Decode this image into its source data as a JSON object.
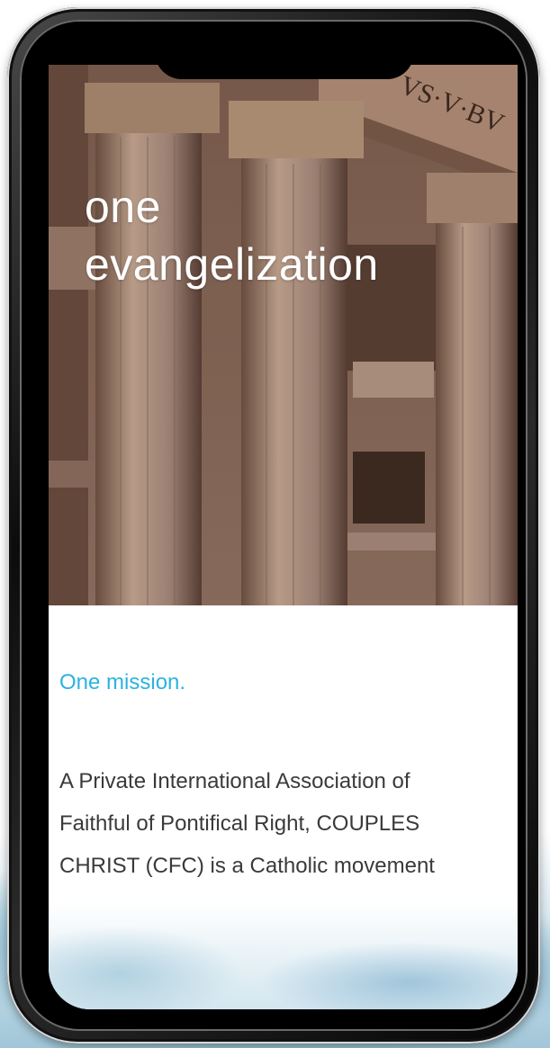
{
  "hero": {
    "title_line1": "one",
    "title_line2": "evangelization",
    "inscription": "VS·V·BV"
  },
  "content": {
    "mission_heading": "One mission.",
    "description_lines": [
      "A Private International Association of",
      "Faithful of Pontifical Right, COUPLES",
      "CHRIST (CFC) is a Catholic movement"
    ]
  },
  "colors": {
    "accent": "#2bb3e0",
    "body_text": "#3a3a3a",
    "hero_text": "#ffffff"
  }
}
